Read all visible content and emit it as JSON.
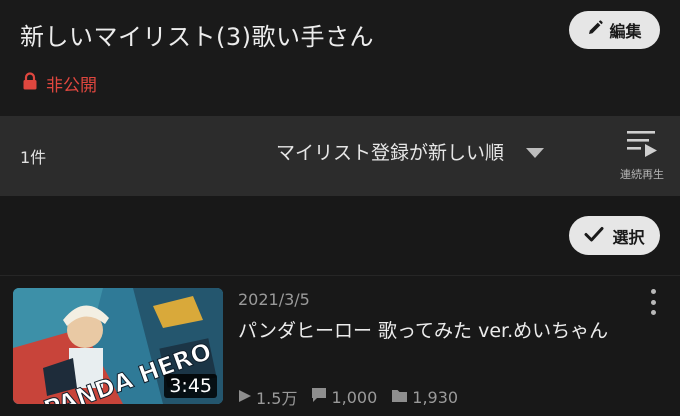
{
  "header": {
    "title": "新しいマイリスト(3)歌い手さん",
    "edit_label": "編集",
    "visibility_label": "非公開"
  },
  "toolbar": {
    "count": "1件",
    "sort_label": "マイリスト登録が新しい順",
    "continuous_label": "連続再生"
  },
  "actions": {
    "select_label": "選択"
  },
  "videos": [
    {
      "date": "2021/3/5",
      "title": "パンダヒーロー 歌ってみた ver.めいちゃん",
      "thumbnail_text": "PANDA HERO",
      "duration": "3:45",
      "views": "1.5万",
      "comments": "1,000",
      "mylists": "1,930"
    }
  ],
  "colors": {
    "background": "#181818",
    "toolbar": "#2c2c2c",
    "private_red": "#e0473f",
    "pill": "#e6e6e6"
  },
  "icons": [
    "pencil-icon",
    "lock-icon",
    "dropdown-caret-icon",
    "playlist-play-icon",
    "check-icon",
    "play-icon",
    "comment-icon",
    "folder-icon",
    "more-vert-icon"
  ]
}
